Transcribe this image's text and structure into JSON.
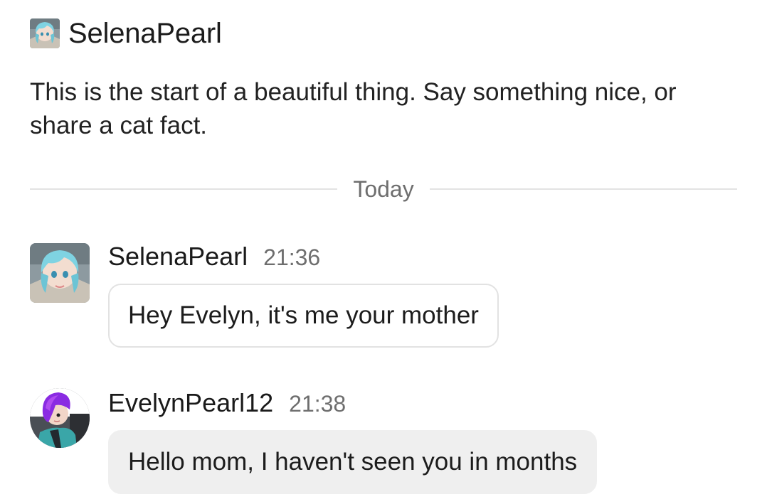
{
  "header": {
    "title": "SelenaPearl",
    "avatar_icon": "anime-avatar-cyan-hair-icon"
  },
  "intro_text": "This is the start of a beautiful thing. Say something nice, or share a cat fact.",
  "divider_label": "Today",
  "messages": [
    {
      "author": "SelenaPearl",
      "time": "21:36",
      "text": "Hey Evelyn, it's me your mother",
      "avatar_icon": "anime-avatar-cyan-hair-icon",
      "bubble_style": "outlined"
    },
    {
      "author": "EvelynPearl12",
      "time": "21:38",
      "text": "Hello mom, I haven't seen you in months",
      "avatar_icon": "anime-avatar-purple-hair-icon",
      "bubble_style": "filled"
    }
  ],
  "colors": {
    "text": "#1c1c1c",
    "muted": "#6e6e6e",
    "divider": "#e3e3e3",
    "bubble_fill": "#efefef",
    "bubble_border": "#e2e2e2"
  }
}
